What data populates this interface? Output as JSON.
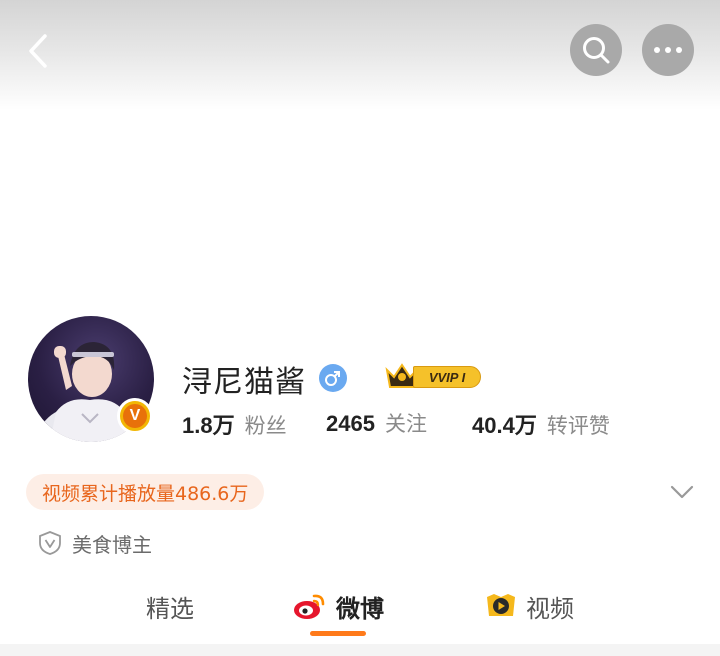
{
  "header": {
    "back_icon": "chevron-left-icon",
    "search_icon": "search-icon",
    "more_icon": "more-dots-icon"
  },
  "profile": {
    "name": "浔尼猫酱",
    "gender_icon": "male-icon",
    "verified_badge": "V",
    "vip_label": "VVIP I"
  },
  "stats": [
    {
      "value": "1.8万",
      "label": "粉丝"
    },
    {
      "value": "2465",
      "label": "关注"
    },
    {
      "value": "40.4万",
      "label": "转评赞"
    }
  ],
  "video_play_count": "视频累计播放量486.6万",
  "tag": {
    "icon": "shield-v-icon",
    "text": "美食博主"
  },
  "tabs": [
    {
      "label": "精选",
      "active": false
    },
    {
      "label": "微博",
      "active": true,
      "icon": "weibo-icon"
    },
    {
      "label": "视频",
      "active": false,
      "icon": "video-play-icon"
    }
  ],
  "colors": {
    "accent": "#ff7a1a",
    "play_pill_bg": "#fdeee6",
    "play_pill_text": "#e8661d",
    "vip_gold": "#f5b81c"
  }
}
